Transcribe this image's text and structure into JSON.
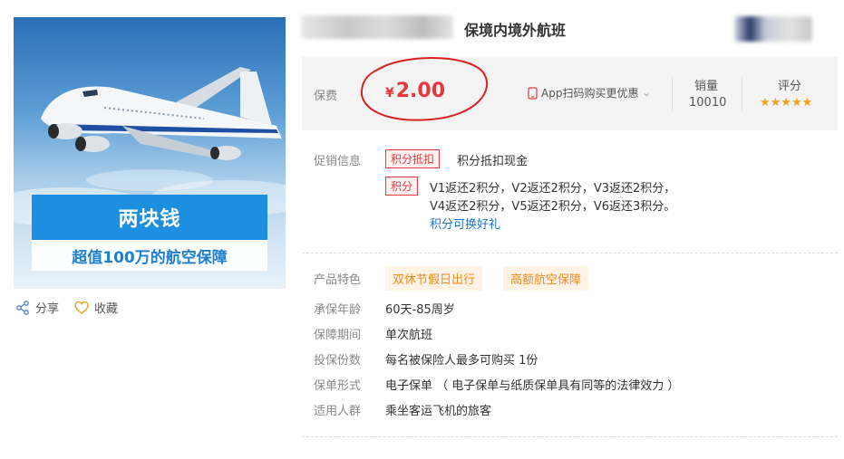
{
  "product": {
    "banner_main": "两块钱",
    "banner_sub": "超值100万的航空保障",
    "title": "保境内境外航班"
  },
  "actions": {
    "share": "分享",
    "favorite": "收藏"
  },
  "price_box": {
    "label": "保费",
    "currency": "¥",
    "price": "2.00",
    "app_buy": "App扫码购买更优惠",
    "sales_label": "销量",
    "sales_value": "10010",
    "rating_label": "评分",
    "rating_stars": "★★★★★",
    "rating_value": 4.5
  },
  "promo": {
    "label": "促销信息",
    "tag1": "积分抵扣",
    "text1": "积分抵扣现金",
    "tag2": "积分",
    "line1": "V1返还2积分，V2返还2积分，V3返还2积分，",
    "line2": "V4返还2积分，V5返还2积分，V6返还3积分。",
    "link": "积分可换好礼"
  },
  "features": {
    "label": "产品特色",
    "tags": [
      "双休节假日出行",
      "高额航空保障"
    ]
  },
  "details": [
    {
      "label": "承保年龄",
      "value": "60天-85周岁"
    },
    {
      "label": "保障期间",
      "value": "单次航班"
    },
    {
      "label": "投保份数",
      "value": "每名被保险人最多可购买 1份"
    },
    {
      "label": "保单形式",
      "value": "电子保单 （ 电子保单与纸质保单具有同等的法律效力 ）"
    },
    {
      "label": "适用人群",
      "value": "乘坐客运飞机的旅客"
    }
  ],
  "colors": {
    "price_red": "#e4393c",
    "accent_blue": "#1d8fe0",
    "star_orange": "#f0a21b",
    "tag_orange": "#f08a1c"
  }
}
